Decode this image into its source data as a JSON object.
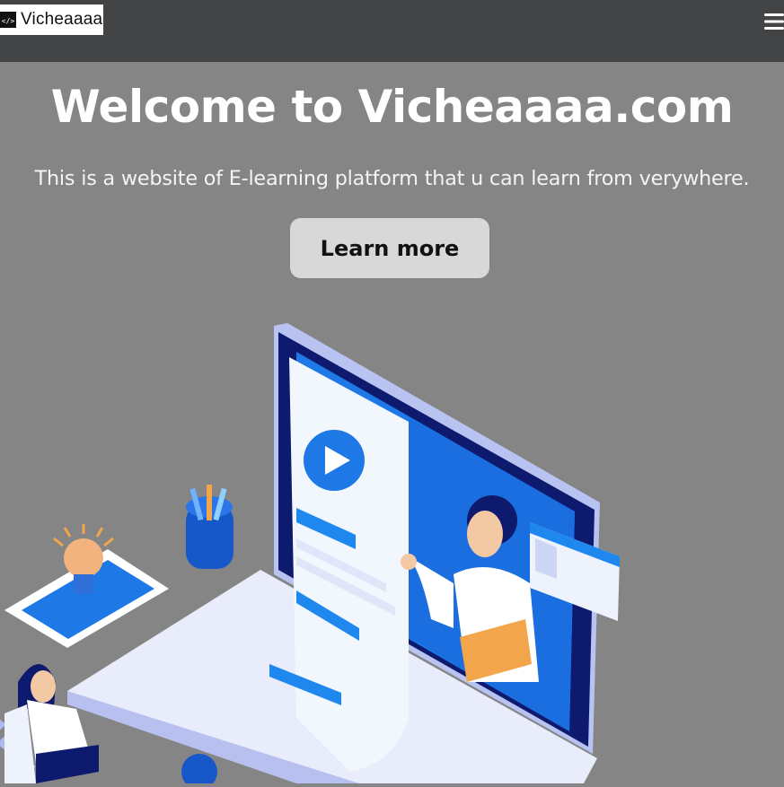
{
  "navbar": {
    "brand": "Vicheaaaa",
    "logo_icon": "code-icon",
    "menu_icon": "hamburger-menu-icon"
  },
  "hero": {
    "title": "Welcome to Vicheaaaa.com",
    "subtitle": "This is a website of E-learning platform that u can learn from verywhere.",
    "cta_label": "Learn more"
  },
  "illustration": {
    "subject": "online-learning-laptop-illustration",
    "colors": {
      "background": "#858585",
      "navbar": "#434445",
      "laptop_blue": "#1e78e6",
      "screen_dark": "#0d1a6e",
      "paper": "#f2f6fd",
      "keys": "#aeb9f0"
    }
  }
}
